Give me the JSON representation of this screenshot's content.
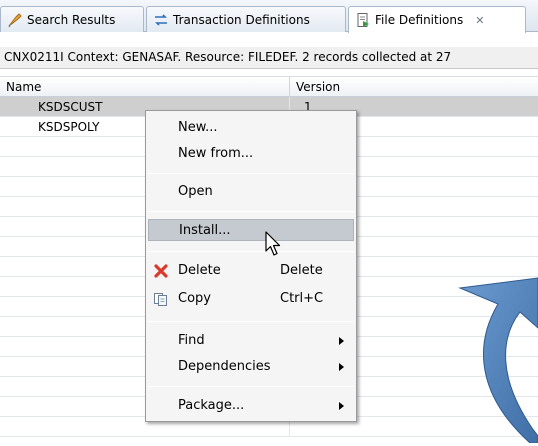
{
  "tabs": [
    {
      "label": "Search Results",
      "icon": "search-results-icon"
    },
    {
      "label": "Transaction Definitions",
      "icon": "transaction-icon"
    },
    {
      "label": "File Definitions",
      "icon": "file-definitions-icon",
      "active": true
    }
  ],
  "status_text": "CNX0211I Context: GENASAF. Resource: FILEDEF. 2 records collected at 27",
  "table": {
    "columns": [
      "Name",
      "Version"
    ],
    "rows": [
      {
        "name": "KSDSCUST",
        "version": "1",
        "selected": true
      },
      {
        "name": "KSDSPOLY",
        "version": ""
      }
    ]
  },
  "context_menu": {
    "items": [
      {
        "label": "New...",
        "shortcut": "",
        "submenu": false
      },
      {
        "label": "New from...",
        "shortcut": "",
        "submenu": false
      },
      {
        "label": "Open",
        "shortcut": "",
        "submenu": false
      },
      {
        "label": "Install...",
        "shortcut": "",
        "submenu": false,
        "hovered": true
      },
      {
        "label": "Delete",
        "shortcut": "Delete",
        "icon": "delete-x-icon"
      },
      {
        "label": "Copy",
        "shortcut": "Ctrl+C",
        "icon": "copy-icon"
      },
      {
        "label": "Find",
        "shortcut": "",
        "submenu": true
      },
      {
        "label": "Dependencies",
        "shortcut": "",
        "submenu": true
      },
      {
        "label": "Package...",
        "shortcut": "",
        "submenu": true
      }
    ]
  },
  "colors": {
    "arrow": "#4a7fb5",
    "selected_row": "#cfcfcf",
    "menu_hover": "#c5c9d0",
    "delete_icon": "#d93a2b"
  }
}
